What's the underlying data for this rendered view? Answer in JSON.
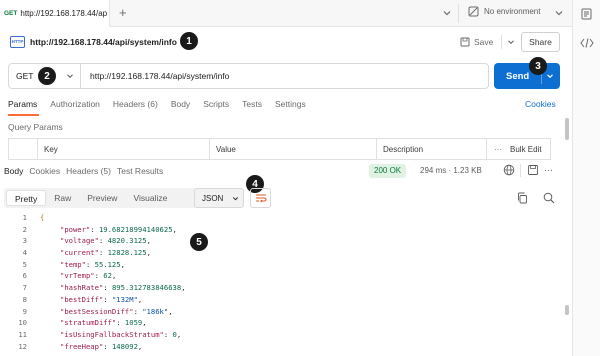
{
  "tab": {
    "method": "GET",
    "title": "http://192.168.178.44/ap"
  },
  "environment": {
    "label": "No environment"
  },
  "request": {
    "title": "http://192.168.178.44/api/system/info",
    "method": "GET",
    "url": "http://192.168.178.44/api/system/info",
    "save_label": "Save",
    "share_label": "Share",
    "send_label": "Send"
  },
  "request_tabs": [
    "Params",
    "Authorization",
    "Headers (6)",
    "Body",
    "Scripts",
    "Tests",
    "Settings"
  ],
  "cookies_label": "Cookies",
  "query_params": {
    "title": "Query Params",
    "headers": {
      "key": "Key",
      "value": "Value",
      "description": "Description",
      "bulk_edit": "Bulk Edit"
    }
  },
  "response": {
    "tabs": [
      "Body",
      "Cookies",
      "Headers (5)",
      "Test Results"
    ],
    "status": "200 OK",
    "meta": "294 ms  ·  1.23 KB",
    "view_modes": [
      "Pretty",
      "Raw",
      "Preview",
      "Visualize"
    ],
    "format": "JSON"
  },
  "code_lines": [
    {
      "n": "1",
      "text": "{",
      "kind": "brace"
    },
    {
      "n": "2",
      "key": "\"power\"",
      "value": "19.68218994140625",
      "vkind": "num"
    },
    {
      "n": "3",
      "key": "\"voltage\"",
      "value": "4820.3125",
      "vkind": "num"
    },
    {
      "n": "4",
      "key": "\"current\"",
      "value": "12828.125",
      "vkind": "num"
    },
    {
      "n": "5",
      "key": "\"temp\"",
      "value": "55.125",
      "vkind": "num"
    },
    {
      "n": "6",
      "key": "\"vrTemp\"",
      "value": "62",
      "vkind": "num"
    },
    {
      "n": "7",
      "key": "\"hashRate\"",
      "value": "895.312783846638",
      "vkind": "num"
    },
    {
      "n": "8",
      "key": "\"bestDiff\"",
      "value": "\"132M\"",
      "vkind": "str"
    },
    {
      "n": "9",
      "key": "\"bestSessionDiff\"",
      "value": "\"186k\"",
      "vkind": "str"
    },
    {
      "n": "10",
      "key": "\"stratumDiff\"",
      "value": "1059",
      "vkind": "num"
    },
    {
      "n": "11",
      "key": "\"isUsingFallbackStratum\"",
      "value": "0",
      "vkind": "num"
    },
    {
      "n": "12",
      "key": "\"freeHeap\"",
      "value": "148092",
      "vkind": "num"
    }
  ],
  "annotations": [
    "1",
    "2",
    "3",
    "4",
    "5"
  ],
  "colors": {
    "accent": "#ff6c37",
    "send": "#0e6fd3",
    "status_bg": "#dff2e4",
    "badge": "#1a1a1a"
  },
  "icons": [
    "plus-icon",
    "chevron-down-icon",
    "no-environment-icon",
    "http-icon",
    "save-icon",
    "code-icon",
    "more-icon",
    "globe-icon",
    "save-response-icon",
    "copy-icon",
    "search-icon",
    "wrap-icon"
  ]
}
